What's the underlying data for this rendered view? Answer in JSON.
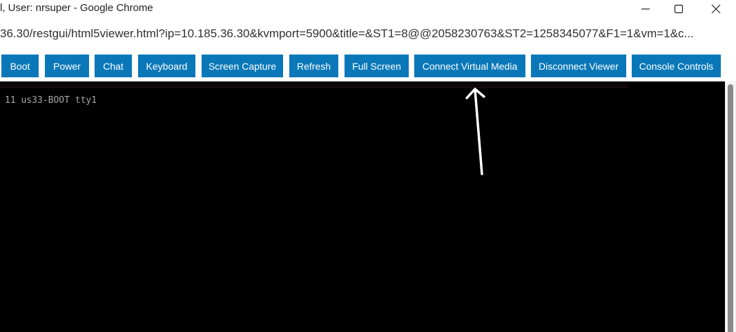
{
  "window": {
    "title": "l, User: nrsuper - Google Chrome"
  },
  "address_bar": {
    "url": "36.30/restgui/html5viewer.html?ip=10.185.36.30&kvmport=5900&title=&ST1=8@@2058230763&ST2=1258345077&F1=1&vm=1&c..."
  },
  "toolbar": {
    "buttons": [
      {
        "id": "boot",
        "label": "Boot"
      },
      {
        "id": "power",
        "label": "Power"
      },
      {
        "id": "chat",
        "label": "Chat"
      },
      {
        "id": "keyboard",
        "label": "Keyboard"
      },
      {
        "id": "screen-capture",
        "label": "Screen Capture"
      },
      {
        "id": "refresh",
        "label": "Refresh"
      },
      {
        "id": "full-screen",
        "label": "Full Screen"
      },
      {
        "id": "connect-virtual-media",
        "label": "Connect Virtual Media"
      },
      {
        "id": "disconnect-viewer",
        "label": "Disconnect Viewer"
      },
      {
        "id": "console-controls",
        "label": "Console Controls"
      }
    ],
    "button_color": "#0a78b8"
  },
  "console": {
    "text": "11 us33-BOOT tty1",
    "background": "#000000",
    "text_color": "#a8a8a8"
  },
  "icons": {
    "minimize": "minimize-icon",
    "maximize": "maximize-icon",
    "close": "close-icon",
    "annotation": "arrow-up-icon"
  }
}
